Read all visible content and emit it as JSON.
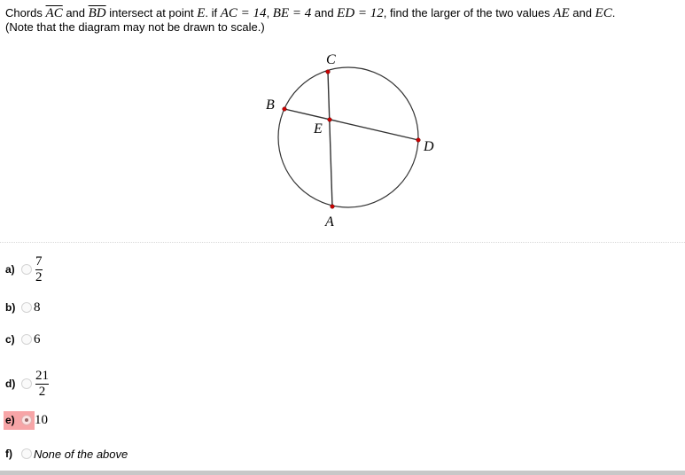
{
  "question": {
    "line1": {
      "p1": "Chords ",
      "chord1": "AC",
      "p2": " and ",
      "chord2": "BD",
      "p3": " intersect at point ",
      "point": "E",
      "p4": ".  if ",
      "g1": "AC = 14",
      "p5": ", ",
      "g2": "BE = 4",
      "p6": " and ",
      "g3": "ED = 12",
      "p7": ", find the larger of the two values ",
      "v1": "AE",
      "p8": " and ",
      "v2": "EC",
      "p9": "."
    },
    "line2": "(Note that the diagram may not be drawn to scale.)"
  },
  "diagram": {
    "labels": {
      "A": "A",
      "B": "B",
      "C": "C",
      "D": "D",
      "E": "E"
    },
    "point_color": "#cc0000"
  },
  "choices": [
    {
      "letter": "a)",
      "type": "fraction",
      "numerator": "7",
      "denominator": "2",
      "selected": false
    },
    {
      "letter": "b)",
      "type": "number",
      "value": "8",
      "selected": false
    },
    {
      "letter": "c)",
      "type": "number",
      "value": "6",
      "selected": false
    },
    {
      "letter": "d)",
      "type": "fraction",
      "numerator": "21",
      "denominator": "2",
      "selected": false
    },
    {
      "letter": "e)",
      "type": "number",
      "value": "10",
      "selected": true
    },
    {
      "letter": "f)",
      "type": "text",
      "value": "None of the above",
      "selected": false
    }
  ],
  "highlight_color": "#f7a5a7"
}
